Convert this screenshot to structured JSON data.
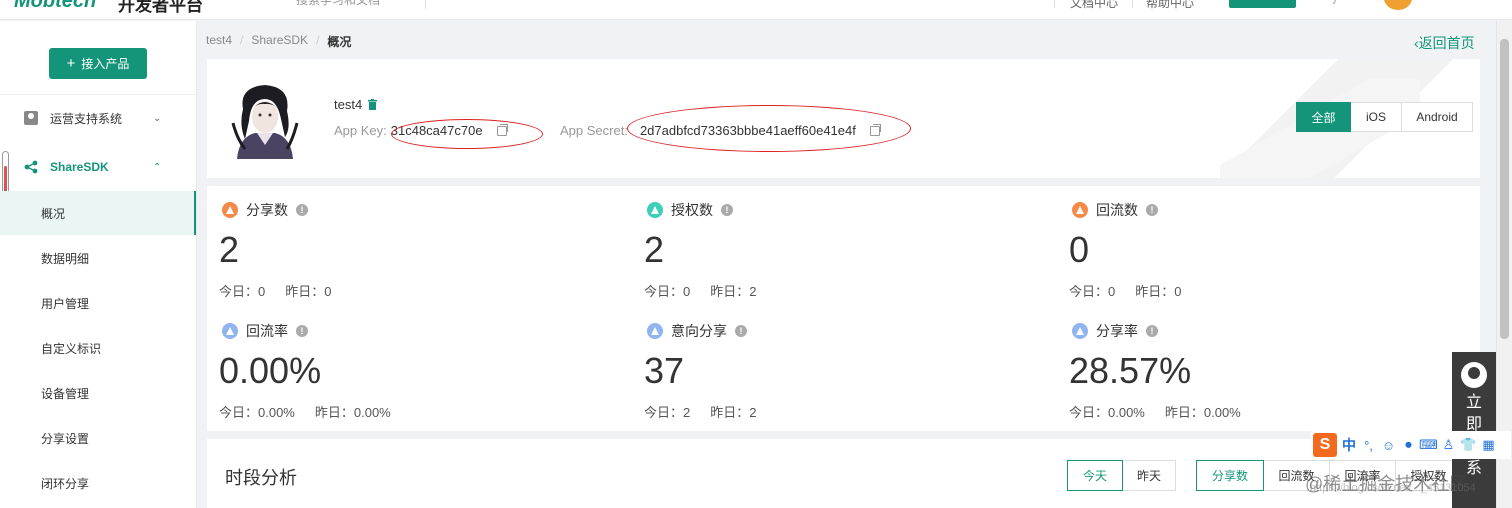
{
  "topbar": {
    "logo": "Mobtech",
    "portal": "开发者平台",
    "search_placeholder": "搜索学习和文档",
    "items": [
      "文档中心",
      "帮助中心"
    ]
  },
  "sidebar": {
    "add_button": "接入产品",
    "groups": [
      {
        "label": "运营支持系统",
        "expanded": false
      },
      {
        "label": "ShareSDK",
        "expanded": true
      }
    ],
    "sub_items": [
      "概况",
      "数据明细",
      "用户管理",
      "自定义标识",
      "设备管理",
      "分享设置",
      "闭环分享"
    ],
    "active_sub": "概况"
  },
  "breadcrumb": [
    "test4",
    "ShareSDK",
    "概况"
  ],
  "back_link": "返回首页",
  "product": {
    "name": "test4",
    "app_key_label": "App Key:",
    "app_key": "31c48ca47c70e",
    "app_secret_label": "App Secret:",
    "app_secret": "2d7adbfcd73363bbbe41aeff60e41e4f"
  },
  "platform_tabs": [
    "全部",
    "iOS",
    "Android"
  ],
  "active_platform": "全部",
  "stats": [
    {
      "label": "分享数",
      "value": "2",
      "today": "今日：0",
      "yesterday": "昨日：0",
      "color": "#f5894a"
    },
    {
      "label": "授权数",
      "value": "2",
      "today": "今日：0",
      "yesterday": "昨日：2",
      "color": "#3dcfb8"
    },
    {
      "label": "回流数",
      "value": "0",
      "today": "今日：0",
      "yesterday": "昨日：0",
      "color": "#f5894a"
    },
    {
      "label": "回流率",
      "value": "0.00%",
      "today": "今日：0.00%",
      "yesterday": "昨日：0.00%",
      "color": "#8fb4f0"
    },
    {
      "label": "意向分享",
      "value": "37",
      "today": "今日：2",
      "yesterday": "昨日：2",
      "color": "#8fb4f0"
    },
    {
      "label": "分享率",
      "value": "28.57%",
      "today": "今日：0.00%",
      "yesterday": "昨日：0.00%",
      "color": "#8fb4f0"
    }
  ],
  "analysis": {
    "title": "时段分析",
    "day_buttons": [
      "今天",
      "昨天"
    ],
    "metric_buttons": [
      "分享数",
      "回流数",
      "回流率",
      "授权数"
    ]
  },
  "float_contact": "立即联系",
  "ime": {
    "lang": "中",
    "punct": "°,"
  },
  "watermark": "@稀土掘金技术社区",
  "watermark_small": "https://blog.csdn.net/..._45131054",
  "accent_color": "#14957a"
}
